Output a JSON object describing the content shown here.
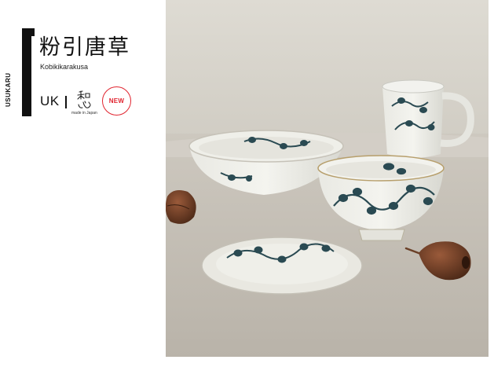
{
  "product": {
    "series_code": "USUKARU",
    "title": "粉引唐草",
    "subtitle": "Kobikikarakusa",
    "country_code": "UK",
    "washin_mark": "和心",
    "made_in": "made in Japan",
    "badge": "NEW"
  },
  "colors": {
    "accent_red": "#e1242f",
    "text_dark": "#111111",
    "glaze_white": "#eeeee8",
    "indigo_pattern": "#2a4a52"
  },
  "photo": {
    "icon": "tableware-photo"
  }
}
